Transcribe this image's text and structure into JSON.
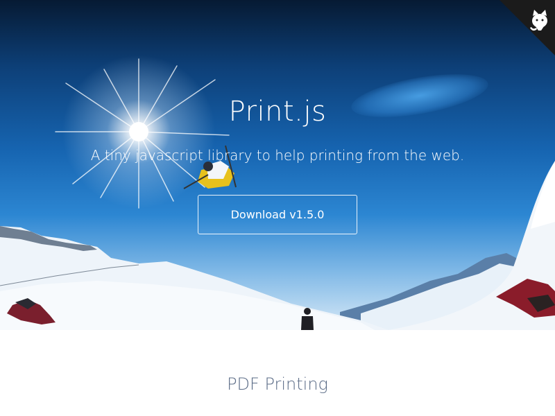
{
  "hero": {
    "title": "Print.js",
    "subtitle": "A tiny javascript library to help printing from the web.",
    "download_label": "Download v1.5.0",
    "github_icon": "github-octocat-icon"
  },
  "section": {
    "title": "PDF Printing"
  },
  "colors": {
    "sky_dark": "#061a33",
    "sky_blue": "#1664b0",
    "snow": "#f4f8fc",
    "section_title": "#5a6b86",
    "white": "#ffffff"
  }
}
